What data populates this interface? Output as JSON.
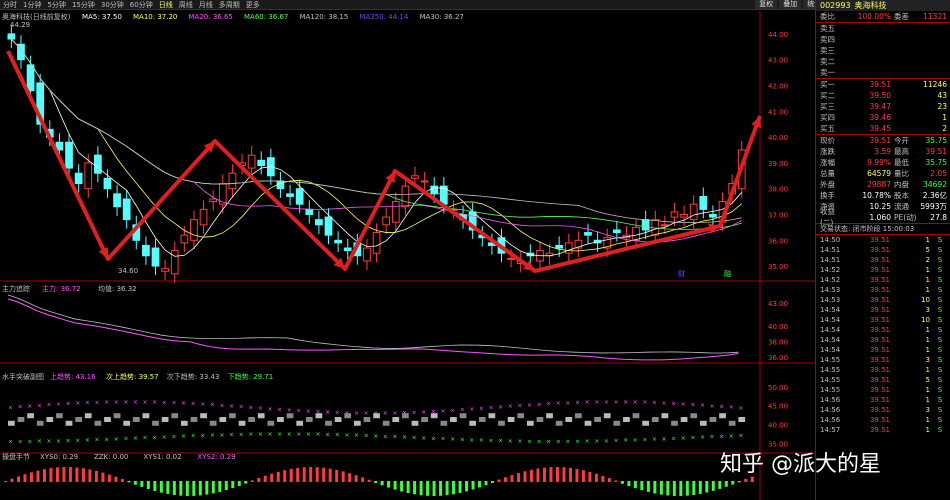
{
  "periods": [
    "分时",
    "1分钟",
    "5分钟",
    "15分钟",
    "30分钟",
    "60分钟",
    "日线",
    "周线",
    "月线",
    "多周期",
    "更多"
  ],
  "active_period": "日线",
  "top_buttons": [
    "复权",
    "叠加",
    "统计",
    "画线",
    "F10",
    "标记",
    "+自选",
    "返回"
  ],
  "main": {
    "title": "奥海科技(日线前复权)",
    "ma": [
      {
        "label": "MA5: 37.50",
        "color": "#ffffff"
      },
      {
        "label": "MA10: 37.20",
        "color": "#ffff54"
      },
      {
        "label": "MA20: 36.65",
        "color": "#ff54ff"
      },
      {
        "label": "MA60: 36.67",
        "color": "#54ff54"
      },
      {
        "label": "MA120: 38.15",
        "color": "#c0c0c0"
      },
      {
        "label": "MA250: 44.14",
        "color": "#5454ff"
      },
      {
        "label": "MA30: 36.27",
        "color": "#c0c0c0"
      }
    ],
    "high_label": "44.29",
    "low_label": "34.60",
    "axis": [
      "44.00",
      "43.00",
      "42.00",
      "41.00",
      "40.00",
      "39.00",
      "38.00",
      "37.00",
      "36.00",
      "35.00"
    ],
    "markers": [
      "财",
      "融"
    ]
  },
  "panel2": {
    "title": "主力追踪",
    "items": [
      {
        "label": "主力: 36.72",
        "color": "#ff54ff"
      },
      {
        "label": "均值: 36.32",
        "color": "#c0c0c0"
      }
    ],
    "axis": [
      "43.00",
      "40.00",
      "38.00",
      "36.00"
    ]
  },
  "panel3": {
    "title": "水手突破副图",
    "items": [
      {
        "label": "上趋势: 43.16",
        "color": "#ff54ff"
      },
      {
        "label": "次上趋势: 39.57",
        "color": "#ffff54"
      },
      {
        "label": "次下趋势: 33.43",
        "color": "#c0c0c0"
      },
      {
        "label": "下趋势: 29.71",
        "color": "#3cff3c"
      }
    ],
    "axis": [
      "50.00",
      "45.00",
      "40.00",
      "35.00"
    ]
  },
  "panel4": {
    "title": "操盘手节",
    "items": [
      {
        "label": "XYS0: 0.29",
        "color": "#c0c0c0"
      },
      {
        "label": "ZZK: 0.00",
        "color": "#c0c0c0"
      },
      {
        "label": "XYS1: 0.02",
        "color": "#c0c0c0"
      },
      {
        "label": "XYS2: 0.29",
        "color": "#ff54ff"
      }
    ]
  },
  "side": {
    "code": "002993",
    "name": "奥海科技",
    "weibi": {
      "label": "委比",
      "value": "100.00%",
      "label2": "委差",
      "value2": "11321"
    },
    "sells": [
      "卖五",
      "卖四",
      "卖三",
      "卖二",
      "卖一"
    ],
    "buys": [
      {
        "label": "买一",
        "price": "39.51",
        "vol": "11246"
      },
      {
        "label": "买二",
        "price": "39.50",
        "vol": "43"
      },
      {
        "label": "买三",
        "price": "39.47",
        "vol": "23"
      },
      {
        "label": "买四",
        "price": "39.46",
        "vol": "1"
      },
      {
        "label": "买五",
        "price": "39.45",
        "vol": "2"
      }
    ],
    "stats": [
      {
        "l1": "现价",
        "v1": "39.51",
        "l2": "今开",
        "v2": "35.75",
        "c1": "red",
        "c2": "green"
      },
      {
        "l1": "涨跌",
        "v1": "3.59",
        "l2": "最高",
        "v2": "39.51",
        "c1": "red",
        "c2": "red"
      },
      {
        "l1": "涨幅",
        "v1": "9.99%",
        "l2": "最低",
        "v2": "35.75",
        "c1": "red",
        "c2": "green"
      },
      {
        "l1": "总量",
        "v1": "64579",
        "l2": "量比",
        "v2": "2.05",
        "c1": "yellow",
        "c2": "red"
      },
      {
        "l1": "外盘",
        "v1": "29887",
        "l2": "内盘",
        "v2": "34692",
        "c1": "red",
        "c2": "green"
      },
      {
        "l1": "换手",
        "v1": "10.78%",
        "l2": "股本",
        "v2": "2.36亿",
        "c1": "white",
        "c2": "white"
      },
      {
        "l1": "净资",
        "v1": "10.25",
        "l2": "流通",
        "v2": "5993万",
        "c1": "white",
        "c2": "white"
      },
      {
        "l1": "收益(二)",
        "v1": "1.060",
        "l2": "PE(动)",
        "v2": "27.8",
        "c1": "white",
        "c2": "white"
      }
    ],
    "status": "交易状态: 闭市阶段 15:00:03",
    "trades": [
      {
        "t": "14:50",
        "p": "39.51",
        "v": "1",
        "d": "S"
      },
      {
        "t": "14:51",
        "p": "39.51",
        "v": "5",
        "d": "S"
      },
      {
        "t": "14:51",
        "p": "39.51",
        "v": "2",
        "d": "S"
      },
      {
        "t": "14:52",
        "p": "39.51",
        "v": "1",
        "d": "S"
      },
      {
        "t": "14:52",
        "p": "39.51",
        "v": "1",
        "d": "S"
      },
      {
        "t": "14:53",
        "p": "39.51",
        "v": "1",
        "d": "S"
      },
      {
        "t": "14:53",
        "p": "39.51",
        "v": "10",
        "d": "S"
      },
      {
        "t": "14:54",
        "p": "39.51",
        "v": "3",
        "d": "S"
      },
      {
        "t": "14:54",
        "p": "39.51",
        "v": "10",
        "d": "S"
      },
      {
        "t": "14:54",
        "p": "39.51",
        "v": "1",
        "d": "S"
      },
      {
        "t": "14:54",
        "p": "39.51",
        "v": "1",
        "d": "S"
      },
      {
        "t": "14:54",
        "p": "39.51",
        "v": "1",
        "d": "S"
      },
      {
        "t": "14:55",
        "p": "39.51",
        "v": "3",
        "d": "S"
      },
      {
        "t": "14:55",
        "p": "39.51",
        "v": "1",
        "d": "S"
      },
      {
        "t": "14:55",
        "p": "39.51",
        "v": "5",
        "d": "S"
      },
      {
        "t": "14:55",
        "p": "39.51",
        "v": "1",
        "d": "S"
      },
      {
        "t": "14:56",
        "p": "39.51",
        "v": "1",
        "d": "S"
      },
      {
        "t": "14:56",
        "p": "39.51",
        "v": "3",
        "d": "S"
      },
      {
        "t": "14:56",
        "p": "39.51",
        "v": "1",
        "d": "S"
      },
      {
        "t": "14:57",
        "p": "39.51",
        "v": "1",
        "d": "S"
      }
    ]
  },
  "watermark": "知乎 @派大的星"
}
